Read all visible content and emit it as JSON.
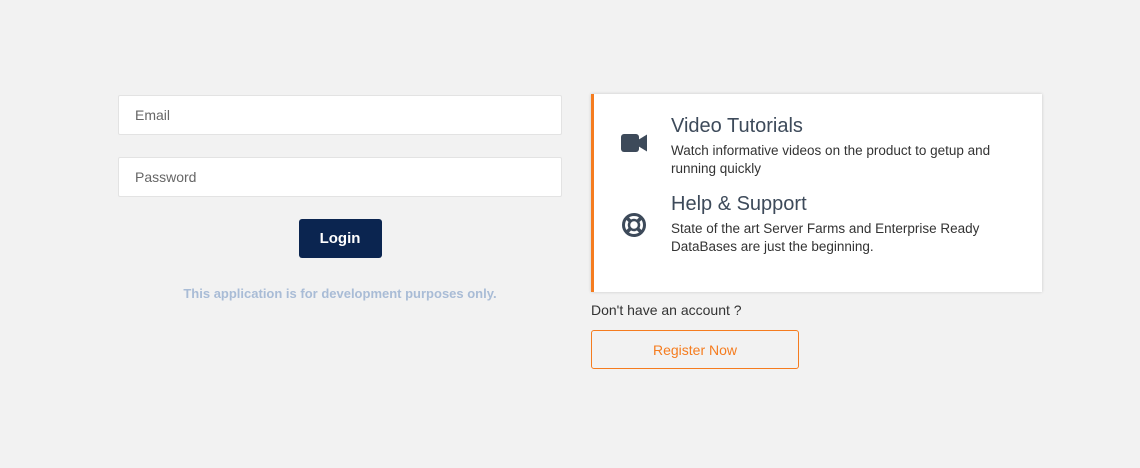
{
  "login": {
    "email_placeholder": "Email",
    "email_value": "",
    "password_placeholder": "Password",
    "password_value": "",
    "login_label": "Login",
    "dev_note": "This application is for development purposes only."
  },
  "info_card": {
    "features": [
      {
        "icon": "video-camera-icon",
        "title": "Video Tutorials",
        "description": "Watch informative videos on the product to getup and running quickly"
      },
      {
        "icon": "lifebuoy-icon",
        "title": "Help & Support",
        "description": "State of the art Server Farms and Enterprise Ready DataBases are just the beginning."
      }
    ]
  },
  "register": {
    "prompt": "Don't have an account ?",
    "button_label": "Register Now"
  },
  "colors": {
    "background": "#f2f2f2",
    "login_button": "#0b2550",
    "accent": "#f57c1f",
    "dev_note": "#a9bcd6",
    "icon": "#3d4a5a"
  }
}
